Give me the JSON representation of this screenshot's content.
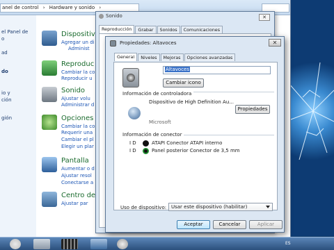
{
  "control_panel": {
    "breadcrumb": [
      "anel de control",
      "›",
      "Hardware y sonido",
      "›"
    ],
    "sidebar": [
      {
        "label": "el Panel de",
        "bold": false
      },
      {
        "label": "o",
        "bold": false
      },
      {
        "label": "ad",
        "bold": false
      },
      {
        "label": "do",
        "bold": true
      },
      {
        "label": "io y",
        "bold": false
      },
      {
        "label": "ción",
        "bold": false
      },
      {
        "label": "gión",
        "bold": false
      }
    ],
    "categories": [
      {
        "title": "Dispositiv",
        "links": [
          "Agregar un di",
          "Administ"
        ]
      },
      {
        "title": "Reproduc",
        "links": [
          "Cambiar la co",
          "Reproducir u"
        ]
      },
      {
        "title": "Sonido",
        "links": [
          "Ajustar volu",
          "Administrar d"
        ]
      },
      {
        "title": "Opciones",
        "links": [
          "Cambiar la co",
          "Requerir una",
          "Cambiar el pl",
          "Elegir un plar"
        ]
      },
      {
        "title": "Pantalla",
        "links": [
          "Aumentar o d",
          "Ajustar resol",
          "Conectarse a"
        ]
      },
      {
        "title": "Centro de",
        "links": [
          "Ajustar par"
        ]
      }
    ]
  },
  "sound_window": {
    "title": "Sonido",
    "close_label": "✕",
    "tabs": [
      "Reproducción",
      "Grabar",
      "Sonidos",
      "Comunicaciones"
    ]
  },
  "properties_dialog": {
    "title": "Propiedades: Altavoces",
    "close_label": "✕",
    "tabs": [
      "General",
      "Niveles",
      "Mejoras",
      "Opciones avanzadas"
    ],
    "device_name": "Altavoces",
    "change_icon_label": "Cambiar icono",
    "controller_heading": "Información de controladora",
    "controller_name": "Dispositivo de High Definition Au...",
    "properties_button": "Propiedades",
    "manufacturer": "Microsoft",
    "connector_heading": "Información de conector",
    "connectors": [
      {
        "id_label": "I D",
        "text": "ATAPI Conector ATAPI interno",
        "color": "#111111"
      },
      {
        "id_label": "I D",
        "text": "Panel posterior Conector de 3,5 mm",
        "color": "#1f8a2e"
      }
    ],
    "usage_label": "Uso de dispositivo:",
    "usage_value": "Usar este dispositivo (habilitar)",
    "ok_label": "Aceptar",
    "cancel_label": "Cancelar",
    "apply_label": "Aplicar"
  },
  "taskbar": {
    "tray_lang": "ES"
  },
  "colors": {
    "link": "#1a54b4",
    "category_title": "#1b6b2e",
    "accent_selection": "#3a72c8"
  }
}
